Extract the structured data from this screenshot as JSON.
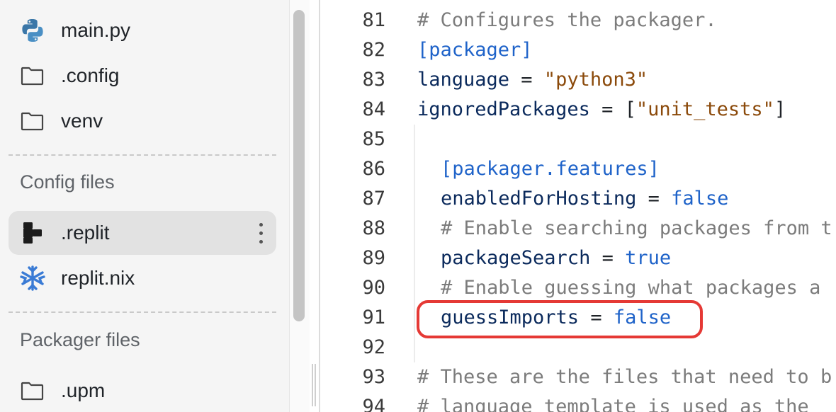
{
  "sidebar": {
    "files": [
      {
        "label": "main.py",
        "icon": "python-icon"
      },
      {
        "label": ".config",
        "icon": "folder-icon"
      },
      {
        "label": "venv",
        "icon": "folder-icon"
      }
    ],
    "config_section": {
      "title": "Config files",
      "files": [
        {
          "label": ".replit",
          "icon": "replit-icon",
          "selected": true
        },
        {
          "label": "replit.nix",
          "icon": "nix-icon"
        }
      ]
    },
    "packager_section": {
      "title": "Packager files",
      "files": [
        {
          "label": ".upm",
          "icon": "folder-icon"
        }
      ]
    }
  },
  "editor": {
    "lines": [
      {
        "num": "81",
        "tokens": [
          {
            "t": "# Configures the packager.",
            "k": "comment"
          }
        ]
      },
      {
        "num": "82",
        "tokens": [
          {
            "t": "[packager]",
            "k": "section"
          }
        ]
      },
      {
        "num": "83",
        "tokens": [
          {
            "t": "language",
            "k": "key"
          },
          {
            "t": " = ",
            "k": "op"
          },
          {
            "t": "\"python3\"",
            "k": "str"
          }
        ]
      },
      {
        "num": "84",
        "tokens": [
          {
            "t": "ignoredPackages",
            "k": "key"
          },
          {
            "t": " = [",
            "k": "op"
          },
          {
            "t": "\"unit_tests\"",
            "k": "str"
          },
          {
            "t": "]",
            "k": "op"
          }
        ]
      },
      {
        "num": "85",
        "tokens": []
      },
      {
        "num": "86",
        "indent": true,
        "tokens": [
          {
            "t": "[packager.features]",
            "k": "section"
          }
        ]
      },
      {
        "num": "87",
        "indent": true,
        "tokens": [
          {
            "t": "enabledForHosting",
            "k": "key"
          },
          {
            "t": " = ",
            "k": "op"
          },
          {
            "t": "false",
            "k": "bool"
          }
        ]
      },
      {
        "num": "88",
        "indent": true,
        "tokens": [
          {
            "t": "# Enable searching packages from t",
            "k": "comment"
          }
        ]
      },
      {
        "num": "89",
        "indent": true,
        "tokens": [
          {
            "t": "packageSearch",
            "k": "key"
          },
          {
            "t": " = ",
            "k": "op"
          },
          {
            "t": "true",
            "k": "bool"
          }
        ]
      },
      {
        "num": "90",
        "indent": true,
        "tokens": [
          {
            "t": "# Enable guessing what packages a",
            "k": "comment"
          }
        ]
      },
      {
        "num": "91",
        "indent": true,
        "tokens": [
          {
            "t": "guessImports",
            "k": "key"
          },
          {
            "t": " = ",
            "k": "op"
          },
          {
            "t": "false",
            "k": "bool"
          }
        ]
      },
      {
        "num": "92",
        "tokens": []
      },
      {
        "num": "93",
        "tokens": [
          {
            "t": "# These are the files that need to b",
            "k": "comment"
          }
        ]
      },
      {
        "num": "94",
        "tokens": [
          {
            "t": "# language template is used as the",
            "k": "comment"
          }
        ]
      }
    ]
  },
  "colors": {
    "highlight_outline": "#e53935",
    "selected_row": "#e2e2e2",
    "keyword_blue": "#1f63c9",
    "string_brown": "#8b4a0b"
  }
}
